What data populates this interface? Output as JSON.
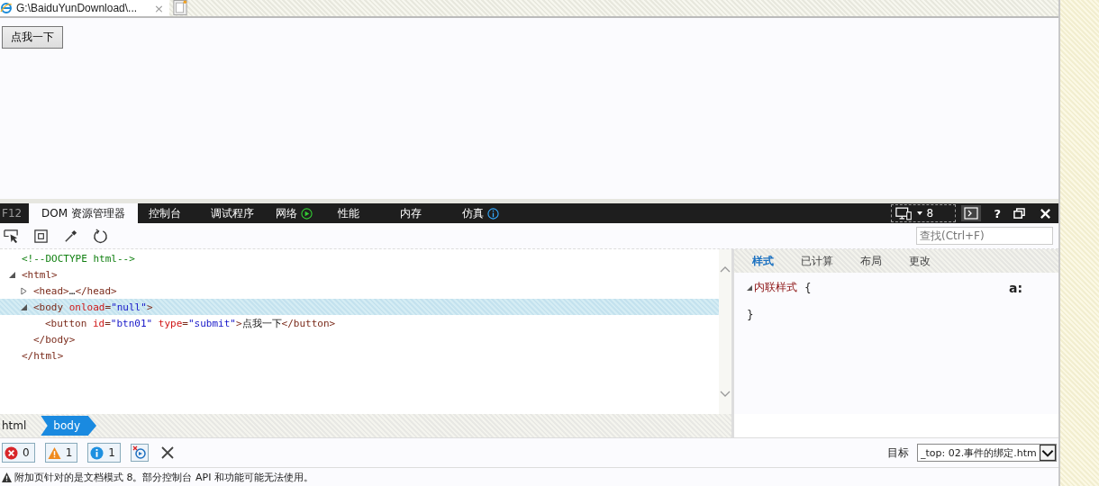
{
  "browser_tab": {
    "title": "G:\\BaiduYunDownload\\...",
    "close": "×"
  },
  "page": {
    "button": "点我一下"
  },
  "devtools": {
    "f12": "F12",
    "tabs": [
      {
        "label": "DOM 资源管理器",
        "selected": true,
        "kind": "plain"
      },
      {
        "label": "控制台",
        "selected": false,
        "kind": "plain"
      },
      {
        "label": "调试程序",
        "selected": false,
        "kind": "plain"
      },
      {
        "label": "网络",
        "selected": false,
        "kind": "play"
      },
      {
        "label": "性能",
        "selected": false,
        "kind": "plain"
      },
      {
        "label": "内存",
        "selected": false,
        "kind": "plain"
      },
      {
        "label": "仿真",
        "selected": false,
        "kind": "info"
      }
    ],
    "doc_mode": "8",
    "help": "?",
    "search": {
      "placeholder": "查找(Ctrl+F)"
    },
    "dom_tree": [
      {
        "tokens": [
          {
            "kind": "comment",
            "text": "<!--DOCTYPE html-->"
          }
        ],
        "selected": false
      },
      {
        "tokens": [
          {
            "kind": "tag",
            "text": "<html>"
          }
        ],
        "expanded": true,
        "selected": false,
        "closing": "</html>",
        "children": [
          {
            "tokens": [
              {
                "kind": "tag",
                "text": "<head>"
              },
              {
                "kind": "text",
                "text": "…"
              },
              {
                "kind": "tag",
                "text": "</head>"
              }
            ],
            "expanded": false,
            "selected": false
          },
          {
            "tokens": [
              {
                "kind": "tag",
                "text": "<body "
              },
              {
                "kind": "attr",
                "text": "onload"
              },
              {
                "kind": "tag",
                "text": "="
              },
              {
                "kind": "value",
                "text": "\"null\""
              },
              {
                "kind": "tag",
                "text": ">"
              }
            ],
            "expanded": true,
            "selected": true,
            "closing": "</body>",
            "children": [
              {
                "tokens": [
                  {
                    "kind": "tag",
                    "text": "<button "
                  },
                  {
                    "kind": "attr",
                    "text": "id"
                  },
                  {
                    "kind": "tag",
                    "text": "="
                  },
                  {
                    "kind": "value",
                    "text": "\"btn01\""
                  },
                  {
                    "kind": "attr",
                    "text": " type"
                  },
                  {
                    "kind": "tag",
                    "text": "="
                  },
                  {
                    "kind": "value",
                    "text": "\"submit\""
                  },
                  {
                    "kind": "tag",
                    "text": ">"
                  },
                  {
                    "kind": "text",
                    "text": "点我一下"
                  },
                  {
                    "kind": "tag",
                    "text": "</button>"
                  }
                ],
                "selected": false
              }
            ]
          }
        ]
      }
    ]
  },
  "style_tabs": [
    {
      "label": "样式",
      "selected": true
    },
    {
      "label": "已计算",
      "selected": false
    },
    {
      "label": "布局",
      "selected": false
    },
    {
      "label": "更改",
      "selected": false
    }
  ],
  "styles": {
    "rule": "内联样式",
    "open": "{",
    "close": "}",
    "pseudo": "a:"
  },
  "breadcrumb": [
    {
      "label": "html",
      "selected": false
    },
    {
      "label": "body",
      "selected": true
    }
  ],
  "console": {
    "errors": "0",
    "warnings": "1",
    "infos": "1",
    "target_label": "目标",
    "target": "_top: 02.事件的绑定.htm"
  },
  "status": "附加页针对的是文档模式 8。部分控制台 API 和功能可能无法使用。"
}
